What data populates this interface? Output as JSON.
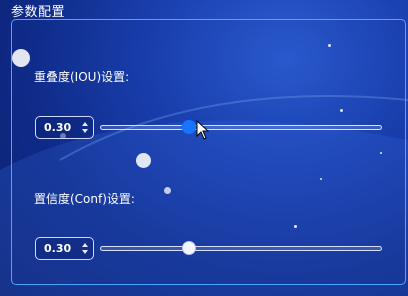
{
  "panel": {
    "title": "参数配置"
  },
  "iou": {
    "label": "重叠度(IOU)设置:",
    "value": "0.30",
    "slider_value": 0.3
  },
  "conf": {
    "label": "置信度(Conf)设置:",
    "value": "0.30",
    "slider_value": 0.3
  },
  "colors": {
    "accent": "#1873ff",
    "panel_border": "#47a6ff",
    "background": "#1a3fae"
  },
  "icons": [
    "spin-up-arrow-icon",
    "spin-down-arrow-icon",
    "mouse-pointer-icon"
  ]
}
